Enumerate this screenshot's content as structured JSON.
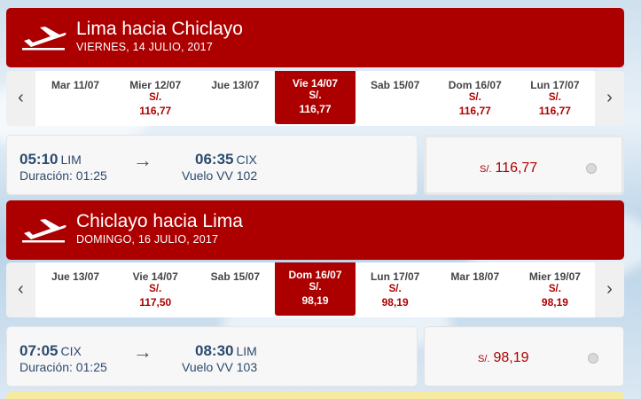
{
  "outbound": {
    "title": "Lima hacia Chiclayo",
    "date": "VIERNES, 14 JULIO, 2017",
    "days": [
      {
        "label": "Mar 11/07",
        "currency": "",
        "price": ""
      },
      {
        "label": "Mier 12/07",
        "currency": "S/.",
        "price": "116,77"
      },
      {
        "label": "Jue 13/07",
        "currency": "",
        "price": ""
      },
      {
        "label": "Vie 14/07",
        "currency": "S/.",
        "price": "116,77"
      },
      {
        "label": "Sab 15/07",
        "currency": "",
        "price": ""
      },
      {
        "label": "Dom 16/07",
        "currency": "S/.",
        "price": "116,77"
      },
      {
        "label": "Lun 17/07",
        "currency": "S/.",
        "price": "116,77"
      }
    ],
    "selected_index": 3,
    "flight": {
      "dep_time": "05:10",
      "dep_code": "LIM",
      "arr_time": "06:35",
      "arr_code": "CIX",
      "duration": "Duración: 01:25",
      "flight_no": "Vuelo VV 102"
    },
    "price": {
      "currency": "S/.",
      "amount": "116,77"
    }
  },
  "return": {
    "title": "Chiclayo hacia Lima",
    "date": "DOMINGO, 16 JULIO, 2017",
    "days": [
      {
        "label": "Jue 13/07",
        "currency": "",
        "price": ""
      },
      {
        "label": "Vie 14/07",
        "currency": "S/.",
        "price": "117,50"
      },
      {
        "label": "Sab 15/07",
        "currency": "",
        "price": ""
      },
      {
        "label": "Dom 16/07",
        "currency": "S/.",
        "price": "98,19"
      },
      {
        "label": "Lun 17/07",
        "currency": "S/.",
        "price": "98,19"
      },
      {
        "label": "Mar 18/07",
        "currency": "",
        "price": ""
      },
      {
        "label": "Mier 19/07",
        "currency": "S/.",
        "price": "98,19"
      }
    ],
    "selected_index": 3,
    "flight": {
      "dep_time": "07:05",
      "dep_code": "CIX",
      "arr_time": "08:30",
      "arr_code": "LIM",
      "duration": "Duración: 01:25",
      "flight_no": "Vuelo VV 103"
    },
    "price": {
      "currency": "S/.",
      "amount": "98,19"
    }
  },
  "icons": {
    "plane": "airplane-takeoff-icon",
    "prev": "chevron-left-icon",
    "next": "chevron-right-icon",
    "arrow": "arrow-right-icon"
  },
  "colors": {
    "brand_red": "#ac0000",
    "text_blue": "#2c4a6e"
  }
}
